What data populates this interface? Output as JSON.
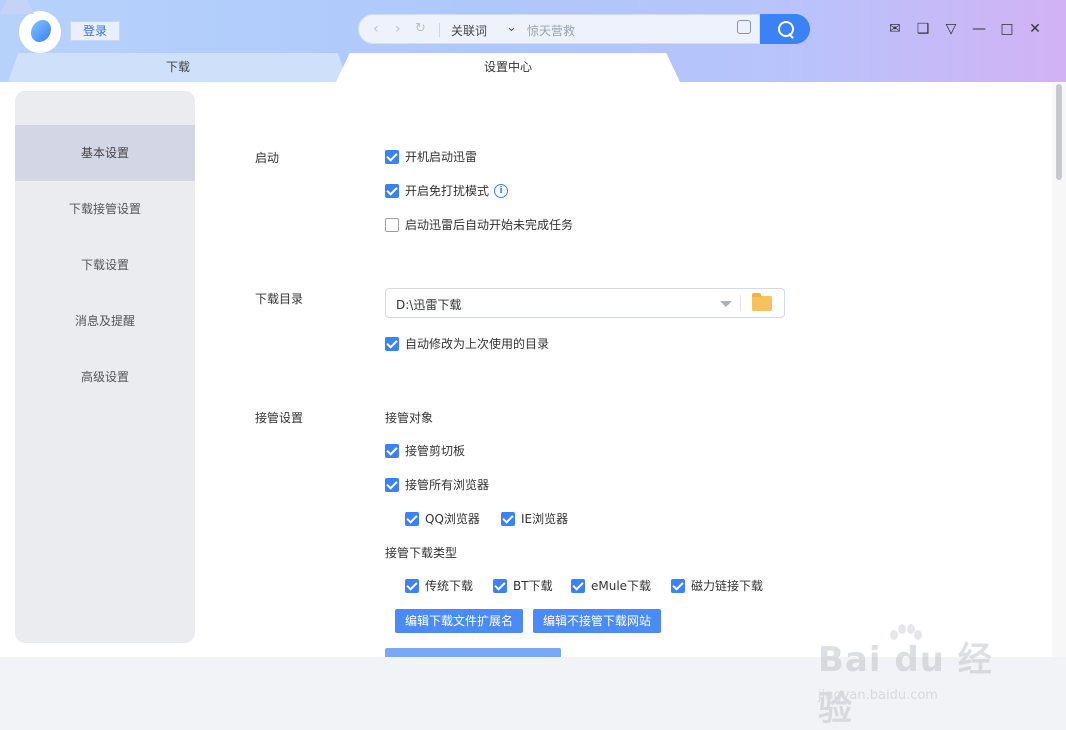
{
  "header": {
    "login_label": "登录",
    "search": {
      "back_icon": "chevron-left-icon",
      "forward_icon": "chevron-right-icon",
      "refresh_icon": "refresh-icon",
      "mode_label": "关联词",
      "placeholder": "惊天营救"
    },
    "window_controls": [
      "mail-icon",
      "skin-icon",
      "menu-icon",
      "minimize-icon",
      "maximize-icon",
      "close-icon"
    ]
  },
  "tabs": [
    {
      "label": "下载"
    },
    {
      "label": "设置中心"
    }
  ],
  "sidebar": {
    "items": [
      {
        "label": "基本设置",
        "active": true
      },
      {
        "label": "下载接管设置"
      },
      {
        "label": "下载设置"
      },
      {
        "label": "消息及提醒"
      },
      {
        "label": "高级设置"
      }
    ]
  },
  "settings": {
    "startup": {
      "label": "启动",
      "options": [
        {
          "label": "开机启动迅雷",
          "checked": true
        },
        {
          "label": "开启免打扰模式",
          "checked": true
        },
        {
          "label": "启动迅雷后自动开始未完成任务",
          "checked": false
        }
      ]
    },
    "download_dir": {
      "label": "下载目录",
      "path": "D:\\迅雷下载",
      "auto_update_label": "自动修改为上次使用的目录",
      "auto_update_checked": true
    },
    "takeover": {
      "label": "接管设置",
      "target_label": "接管对象",
      "clipboard_label": "接管剪切板",
      "all_browsers_label": "接管所有浏览器",
      "qq_browser_label": "QQ浏览器",
      "ie_browser_label": "IE浏览器",
      "types_label": "接管下载类型",
      "types": [
        "传统下载",
        "BT下载",
        "eMule下载",
        "磁力链接下载"
      ],
      "edit_ext_button": "编辑下载文件扩展名",
      "edit_sites_button": "编辑不接管下载网站"
    }
  },
  "watermark": {
    "main": "Bai du 经验",
    "sub": "jingyan.baidu.com"
  },
  "colors": {
    "accent": "#3b82f6",
    "sidebar_bg": "#ebecf0",
    "sidebar_active": "#d3d6e4"
  }
}
